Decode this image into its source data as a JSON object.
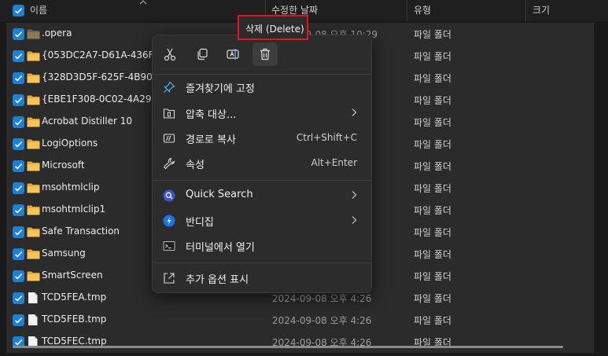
{
  "header": {
    "name_col": "이름",
    "date_col": "수정한 날짜",
    "type_col": "유형",
    "size_col": "크기"
  },
  "rows": [
    {
      "name": ".opera",
      "icon": "folder-dim-icon",
      "date": "2024-09-08 오후 10:29",
      "type": "파일 폴더"
    },
    {
      "name": "{053DC2A7-D61A-436F-B",
      "icon": "folder-icon",
      "date": "",
      "type": "파일 폴더"
    },
    {
      "name": "{328D3D5F-625F-4B90-8",
      "icon": "folder-icon",
      "date": "",
      "type": "파일 폴더"
    },
    {
      "name": "{EBE1F308-0C02-4A29-A",
      "icon": "folder-icon",
      "date": "",
      "type": "파일 폴더"
    },
    {
      "name": "Acrobat Distiller 10",
      "icon": "folder-icon",
      "date": "",
      "type": "파일 폴더"
    },
    {
      "name": "LogiOptions",
      "icon": "folder-icon",
      "date": "",
      "type": "파일 폴더"
    },
    {
      "name": "Microsoft",
      "icon": "folder-icon",
      "date": "",
      "type": "파일 폴더"
    },
    {
      "name": "msohtmlclip",
      "icon": "folder-icon",
      "date": "",
      "type": "파일 폴더"
    },
    {
      "name": "msohtmlclip1",
      "icon": "folder-icon",
      "date": "",
      "type": "파일 폴더"
    },
    {
      "name": "Safe Transaction",
      "icon": "folder-icon",
      "date": "",
      "type": "파일 폴더"
    },
    {
      "name": "Samsung",
      "icon": "folder-icon",
      "date": "",
      "type": "파일 폴더"
    },
    {
      "name": "SmartScreen",
      "icon": "folder-icon",
      "date": "",
      "type": "파일 폴더"
    },
    {
      "name": "TCD5FEA.tmp",
      "icon": "file-icon",
      "date": "2024-09-08 오후 4:26",
      "type": "파일 폴더"
    },
    {
      "name": "TCD5FEB.tmp",
      "icon": "file-icon",
      "date": "2024-09-08 오후 4:26",
      "type": "파일 폴더"
    },
    {
      "name": "TCD5FEC.tmp",
      "icon": "file-icon",
      "date": "2024-09-08 오후 4:26",
      "type": "파일 폴더"
    }
  ],
  "menu": {
    "quick_actions": [
      "cut-icon",
      "copy-icon",
      "rename-icon",
      "delete-icon"
    ],
    "items": [
      {
        "label": "즐겨찾기에 고정",
        "icon": "pin-icon",
        "shortcut": "",
        "submenu": false
      },
      {
        "label": "압축 대상...",
        "icon": "archive-icon",
        "shortcut": "",
        "submenu": true
      },
      {
        "label": "경로로 복사",
        "icon": "copy-path-icon",
        "shortcut": "Ctrl+Shift+C",
        "submenu": false
      },
      {
        "label": "속성",
        "icon": "wrench-icon",
        "shortcut": "Alt+Enter",
        "submenu": false
      },
      {
        "label": "Quick Search",
        "icon": "quick-search-icon",
        "shortcut": "",
        "submenu": true
      },
      {
        "label": "반디집",
        "icon": "bandizip-icon",
        "shortcut": "",
        "submenu": true
      },
      {
        "label": "터미널에서 열기",
        "icon": "terminal-icon",
        "shortcut": "",
        "submenu": false
      },
      {
        "label": "추가 옵션 표시",
        "icon": "more-options-icon",
        "shortcut": "",
        "submenu": false
      }
    ]
  },
  "tooltip": {
    "text": "삭제 (Delete)"
  },
  "colors": {
    "accent": "#1d7fd6",
    "folder": "#f4c35a",
    "highlight": "#e81123",
    "menu_bg": "#2c2c2c",
    "row_bg": "#2b2b2b"
  }
}
